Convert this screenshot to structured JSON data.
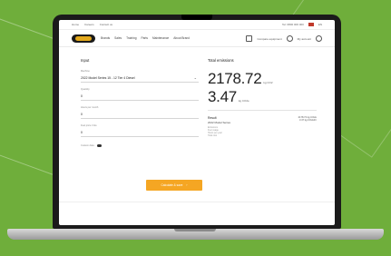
{
  "topbar": {
    "links": [
      "Home",
      "Careers",
      "Contact us"
    ],
    "phone": "Tel: 0800 000 000",
    "lang": "EN"
  },
  "nav": {
    "items": [
      "Brands",
      "Sales",
      "Training",
      "Parts",
      "Maintenance",
      "About Brand"
    ],
    "compare_label": "Compare equipment",
    "account_label": "My account"
  },
  "form": {
    "section_title": "Input",
    "fields": [
      {
        "label": "Machine",
        "value": "2022 Model Series 15 - 12 Tier 4 Diesel"
      },
      {
        "label": "Quantity",
        "value": "0"
      },
      {
        "label": "Hours per month",
        "value": "0"
      },
      {
        "label": "Fuel price / litre",
        "value": "0"
      }
    ],
    "toggle_label": "Custom data",
    "calculate_label": "Calculate & save"
  },
  "results": {
    "title": "Total emissions",
    "value1": "2178.72",
    "unit1": "kg CO2",
    "value2": "3.47",
    "unit2": "kg CO2e",
    "detail_heading": "Result",
    "detail_sub": "2022 Model Series",
    "detail_lines": [
      "Emissions",
      "Fuel usage",
      "Hours per year",
      "Total cost"
    ],
    "detail_right": [
      "2178.72 kg CO2e",
      "3.47 kg CO2e/hr"
    ]
  }
}
